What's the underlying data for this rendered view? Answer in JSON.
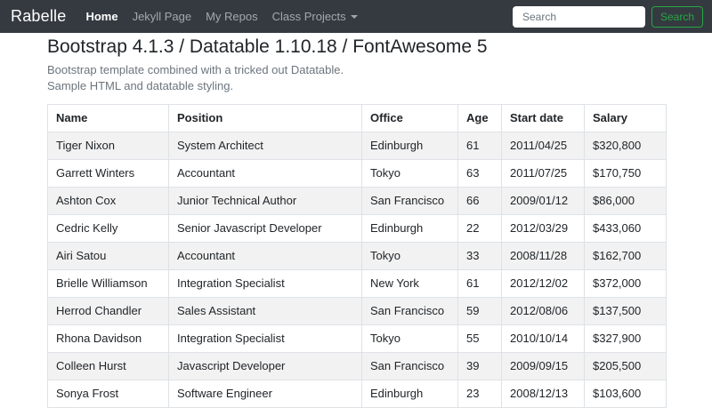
{
  "navbar": {
    "brand": "Rabelle",
    "items": [
      {
        "label": "Home",
        "active": true,
        "dropdown": false
      },
      {
        "label": "Jekyll Page",
        "active": false,
        "dropdown": false
      },
      {
        "label": "My Repos",
        "active": false,
        "dropdown": false
      },
      {
        "label": "Class Projects",
        "active": false,
        "dropdown": true
      }
    ],
    "search": {
      "placeholder": "Search",
      "button_label": "Search"
    }
  },
  "page": {
    "title": "Bootstrap 4.1.3 / Datatable 1.10.18 / FontAwesome 5",
    "subtitle_line1": "Bootstrap template combined with a tricked out Datatable.",
    "subtitle_line2": "Sample HTML and datatable styling."
  },
  "table": {
    "columns": [
      "Name",
      "Position",
      "Office",
      "Age",
      "Start date",
      "Salary"
    ],
    "rows": [
      [
        "Tiger Nixon",
        "System Architect",
        "Edinburgh",
        "61",
        "2011/04/25",
        "$320,800"
      ],
      [
        "Garrett Winters",
        "Accountant",
        "Tokyo",
        "63",
        "2011/07/25",
        "$170,750"
      ],
      [
        "Ashton Cox",
        "Junior Technical Author",
        "San Francisco",
        "66",
        "2009/01/12",
        "$86,000"
      ],
      [
        "Cedric Kelly",
        "Senior Javascript Developer",
        "Edinburgh",
        "22",
        "2012/03/29",
        "$433,060"
      ],
      [
        "Airi Satou",
        "Accountant",
        "Tokyo",
        "33",
        "2008/11/28",
        "$162,700"
      ],
      [
        "Brielle Williamson",
        "Integration Specialist",
        "New York",
        "61",
        "2012/12/02",
        "$372,000"
      ],
      [
        "Herrod Chandler",
        "Sales Assistant",
        "San Francisco",
        "59",
        "2012/08/06",
        "$137,500"
      ],
      [
        "Rhona Davidson",
        "Integration Specialist",
        "Tokyo",
        "55",
        "2010/10/14",
        "$327,900"
      ],
      [
        "Colleen Hurst",
        "Javascript Developer",
        "San Francisco",
        "39",
        "2009/09/15",
        "$205,500"
      ],
      [
        "Sonya Frost",
        "Software Engineer",
        "Edinburgh",
        "23",
        "2008/12/13",
        "$103,600"
      ]
    ]
  },
  "colors": {
    "navbar_bg": "#343a40",
    "accent_green": "#28a745",
    "row_stripe": "#f2f2f2",
    "table_border": "#dee2e6",
    "text": "#212529",
    "muted_text": "#6c757d"
  }
}
